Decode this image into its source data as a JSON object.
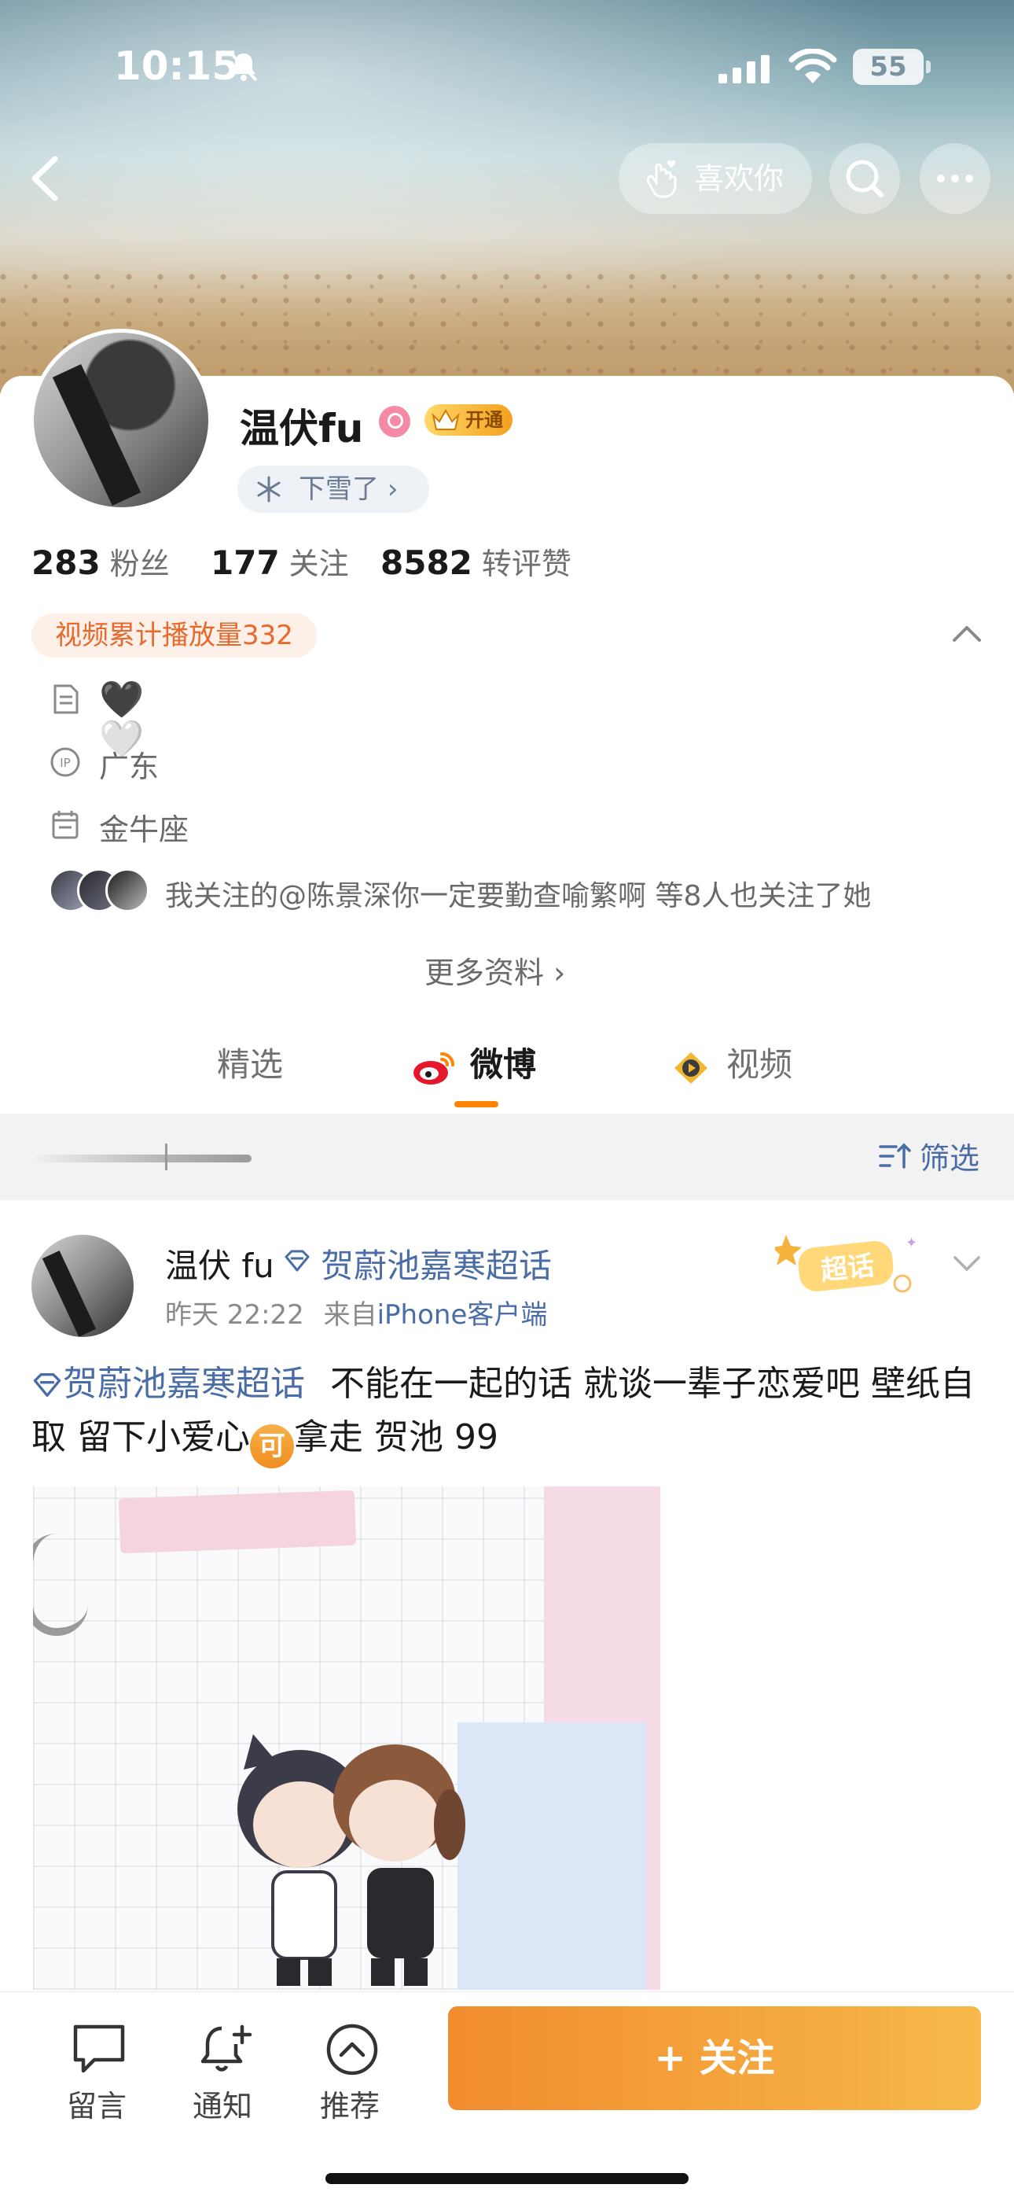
{
  "status_bar": {
    "time": "10:15",
    "battery": "55"
  },
  "header": {
    "like_label": "喜欢你"
  },
  "profile": {
    "name": "温伏fu",
    "vip_label": "开通",
    "status": "下雪了",
    "stats": [
      {
        "value": "283",
        "label": "粉丝"
      },
      {
        "value": "177",
        "label": "关注"
      },
      {
        "value": "8582",
        "label": "转评赞"
      }
    ],
    "video_views": "视频累计播放量332",
    "bio_hearts": [
      "🖤",
      "🤍"
    ],
    "ip": "广东",
    "zodiac": "金牛座",
    "mutual": "我关注的@陈景深你一定要勤查喻繁啊 等8人也关注了她",
    "more_info": "更多资料 ›"
  },
  "tabs": [
    {
      "label": "精选"
    },
    {
      "label": "微博"
    },
    {
      "label": "视频"
    }
  ],
  "filter": {
    "label": "筛选"
  },
  "post": {
    "author": "温伏 fu",
    "topic_header": "贺蔚池嘉寒超话",
    "time": "昨天 22:22",
    "source_prefix": "来自",
    "source": "iPhone客户端",
    "sticker": "超话",
    "text_topic": "贺蔚池嘉寒超话",
    "text_part1": "不能在一起的话 就谈一辈子恋爱吧 壁纸自取 留下小爱心",
    "ke": "可",
    "text_part2": "拿走 贺池 99"
  },
  "bottom_bar": {
    "comment": "留言",
    "notify": "通知",
    "recommend": "推荐",
    "follow": "+ 关注"
  },
  "colors": {
    "accent": "#ff8200",
    "link": "#4a6da7",
    "views_chip": "#e8692b"
  }
}
